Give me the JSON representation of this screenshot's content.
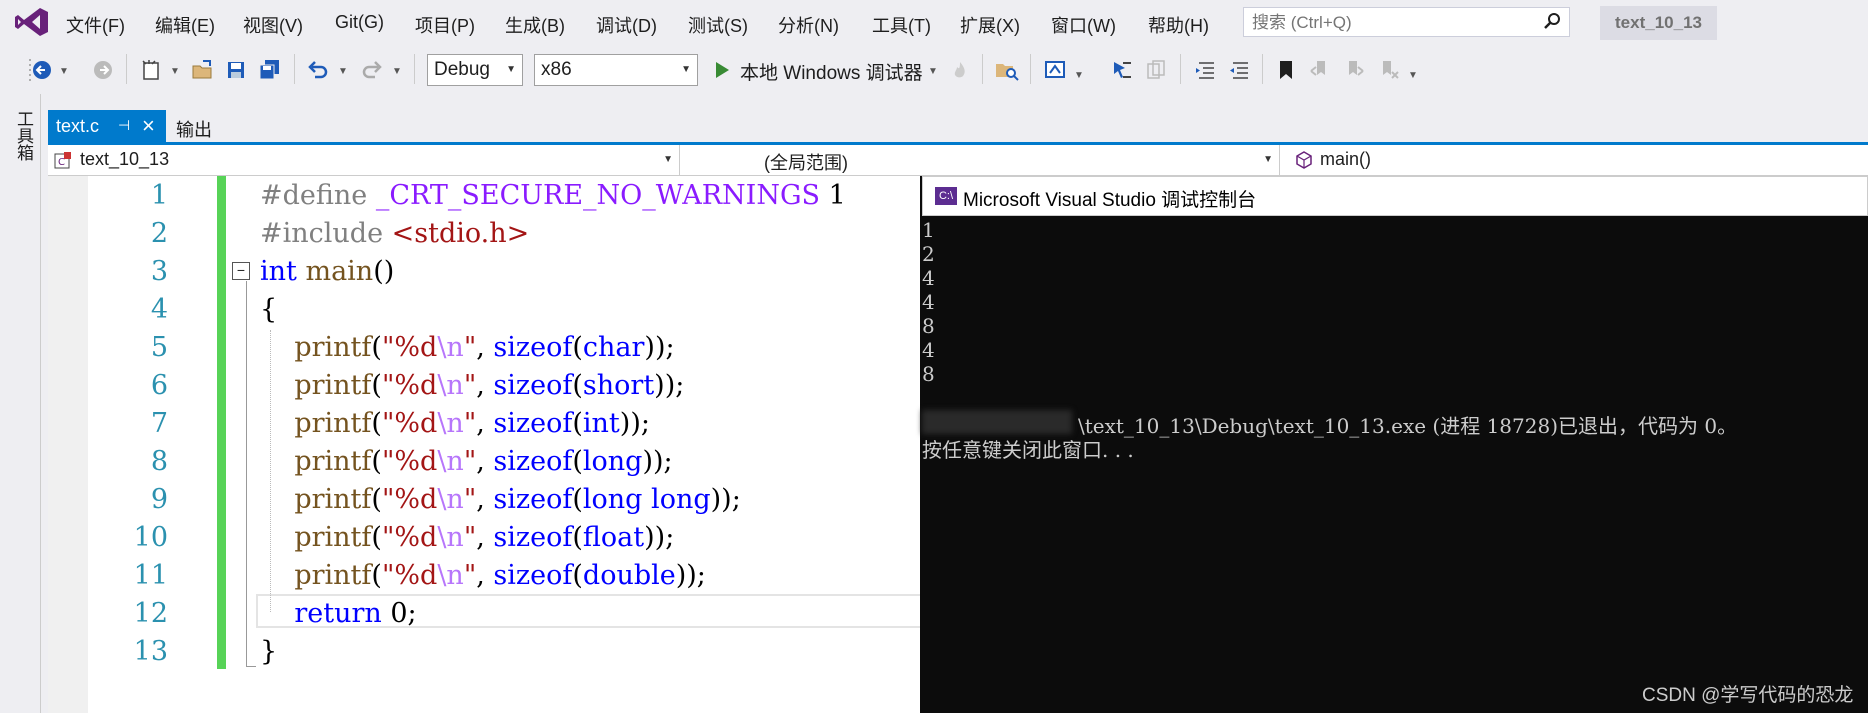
{
  "menu": {
    "items": [
      "文件(F)",
      "编辑(E)",
      "视图(V)",
      "Git(G)",
      "项目(P)",
      "生成(B)",
      "调试(D)",
      "测试(S)",
      "分析(N)",
      "工具(T)",
      "扩展(X)",
      "窗口(W)",
      "帮助(H)"
    ],
    "search_placeholder": "搜索 (Ctrl+Q)",
    "solution_name": "text_10_13"
  },
  "toolbar": {
    "config": "Debug",
    "platform": "x86",
    "run_label": "本地 Windows 调试器"
  },
  "toolbox_label": "工具箱",
  "tabs": {
    "active": "text.c",
    "pin": "⊣",
    "close": "×",
    "output": "输出"
  },
  "navbar": {
    "project": "text_10_13",
    "scope": "(全局范围)",
    "member": "main()"
  },
  "editor": {
    "line_numbers": [
      "1",
      "2",
      "3",
      "4",
      "5",
      "6",
      "7",
      "8",
      "9",
      "10",
      "11",
      "12",
      "13"
    ],
    "collapse_symbol": "−"
  },
  "console": {
    "icon_text": "C:\\",
    "title": "Microsoft Visual Studio 调试控制台",
    "output_lines": [
      "1",
      "2",
      "4",
      "4",
      "8",
      "4",
      "8"
    ],
    "exit_message": "\\text_10_13\\Debug\\text_10_13.exe (进程 18728)已退出，代码为 0。",
    "press_key": "按任意键关闭此窗口. . ."
  },
  "watermark": "CSDN @学写代码的恐龙",
  "colors": {
    "accent": "#007acc",
    "change_bar": "#57d357",
    "line_number": "#2b91af",
    "keyword": "#0000ff"
  }
}
